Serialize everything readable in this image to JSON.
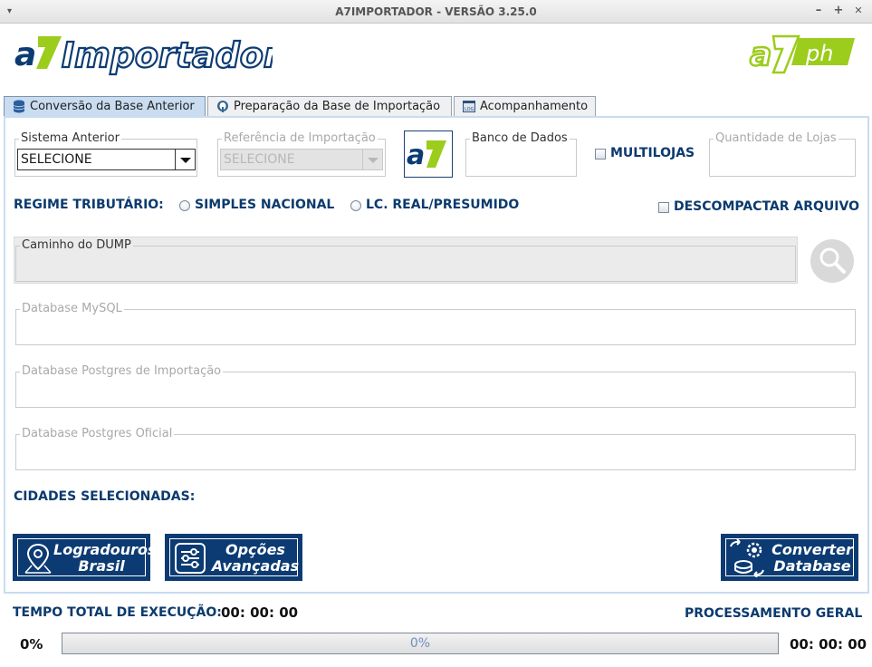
{
  "window": {
    "title": "A7IMPORTADOR - VERSÃO 3.25.0",
    "menu_glyph": "▾",
    "minimize": "–",
    "maximize": "+",
    "close": "✕"
  },
  "header": {
    "logo_text": "Importador",
    "logo_brand": "a7",
    "right_logo_text": "ph"
  },
  "tabs": [
    {
      "label": "Conversão da Base Anterior",
      "active": true,
      "icon": "database-icon"
    },
    {
      "label": "Preparação da Base de Importação",
      "active": false,
      "icon": "postgres-elephant-icon"
    },
    {
      "label": "Acompanhamento",
      "active": false,
      "icon": "log-window-icon"
    }
  ],
  "form": {
    "sistema_anterior": {
      "legend": "Sistema Anterior",
      "value": "SELECIONE"
    },
    "referencia_importacao": {
      "legend": "Referência de Importação",
      "value": "SELECIONE"
    },
    "banco_dados": {
      "legend": "Banco de Dados",
      "value": ""
    },
    "multilojas_label": "MULTILOJAS",
    "quantidade_lojas": {
      "legend": "Quantidade de Lojas",
      "value": ""
    },
    "regime_label": "REGIME TRIBUTÁRIO:",
    "regime_options": [
      "SIMPLES NACIONAL",
      "LC. REAL/PRESUMIDO"
    ],
    "descompactar_label": "DESCOMPACTAR ARQUIVO",
    "caminho_dump": {
      "legend": "Caminho do DUMP",
      "value": ""
    },
    "database_mysql": {
      "legend": "Database MySQL",
      "value": ""
    },
    "database_postgres_importacao": {
      "legend": "Database Postgres de Importação",
      "value": ""
    },
    "database_postgres_oficial": {
      "legend": "Database Postgres Oficial",
      "value": ""
    },
    "cidades_label": "CIDADES SELECIONADAS:"
  },
  "buttons": {
    "logradouros": {
      "line1": "Logradouros",
      "line2": "Brasil"
    },
    "opcoes": {
      "line1": "Opções",
      "line2": "Avançadas"
    },
    "converter": {
      "line1": "Converter",
      "line2": "Database"
    }
  },
  "footer": {
    "tempo_label": "TEMPO TOTAL DE EXECUÇÃO:",
    "tempo_value": "00: 00: 00",
    "processamento_label": "PROCESSAMENTO GERAL",
    "progress_left_pct": "0%",
    "progress_center_pct": "0%",
    "progress_value": 0,
    "progress_time": "00: 00: 00"
  },
  "colors": {
    "brand_navy": "#0c3b73",
    "brand_lime": "#9ccc1c",
    "active_tab": "#c9dcf0"
  }
}
